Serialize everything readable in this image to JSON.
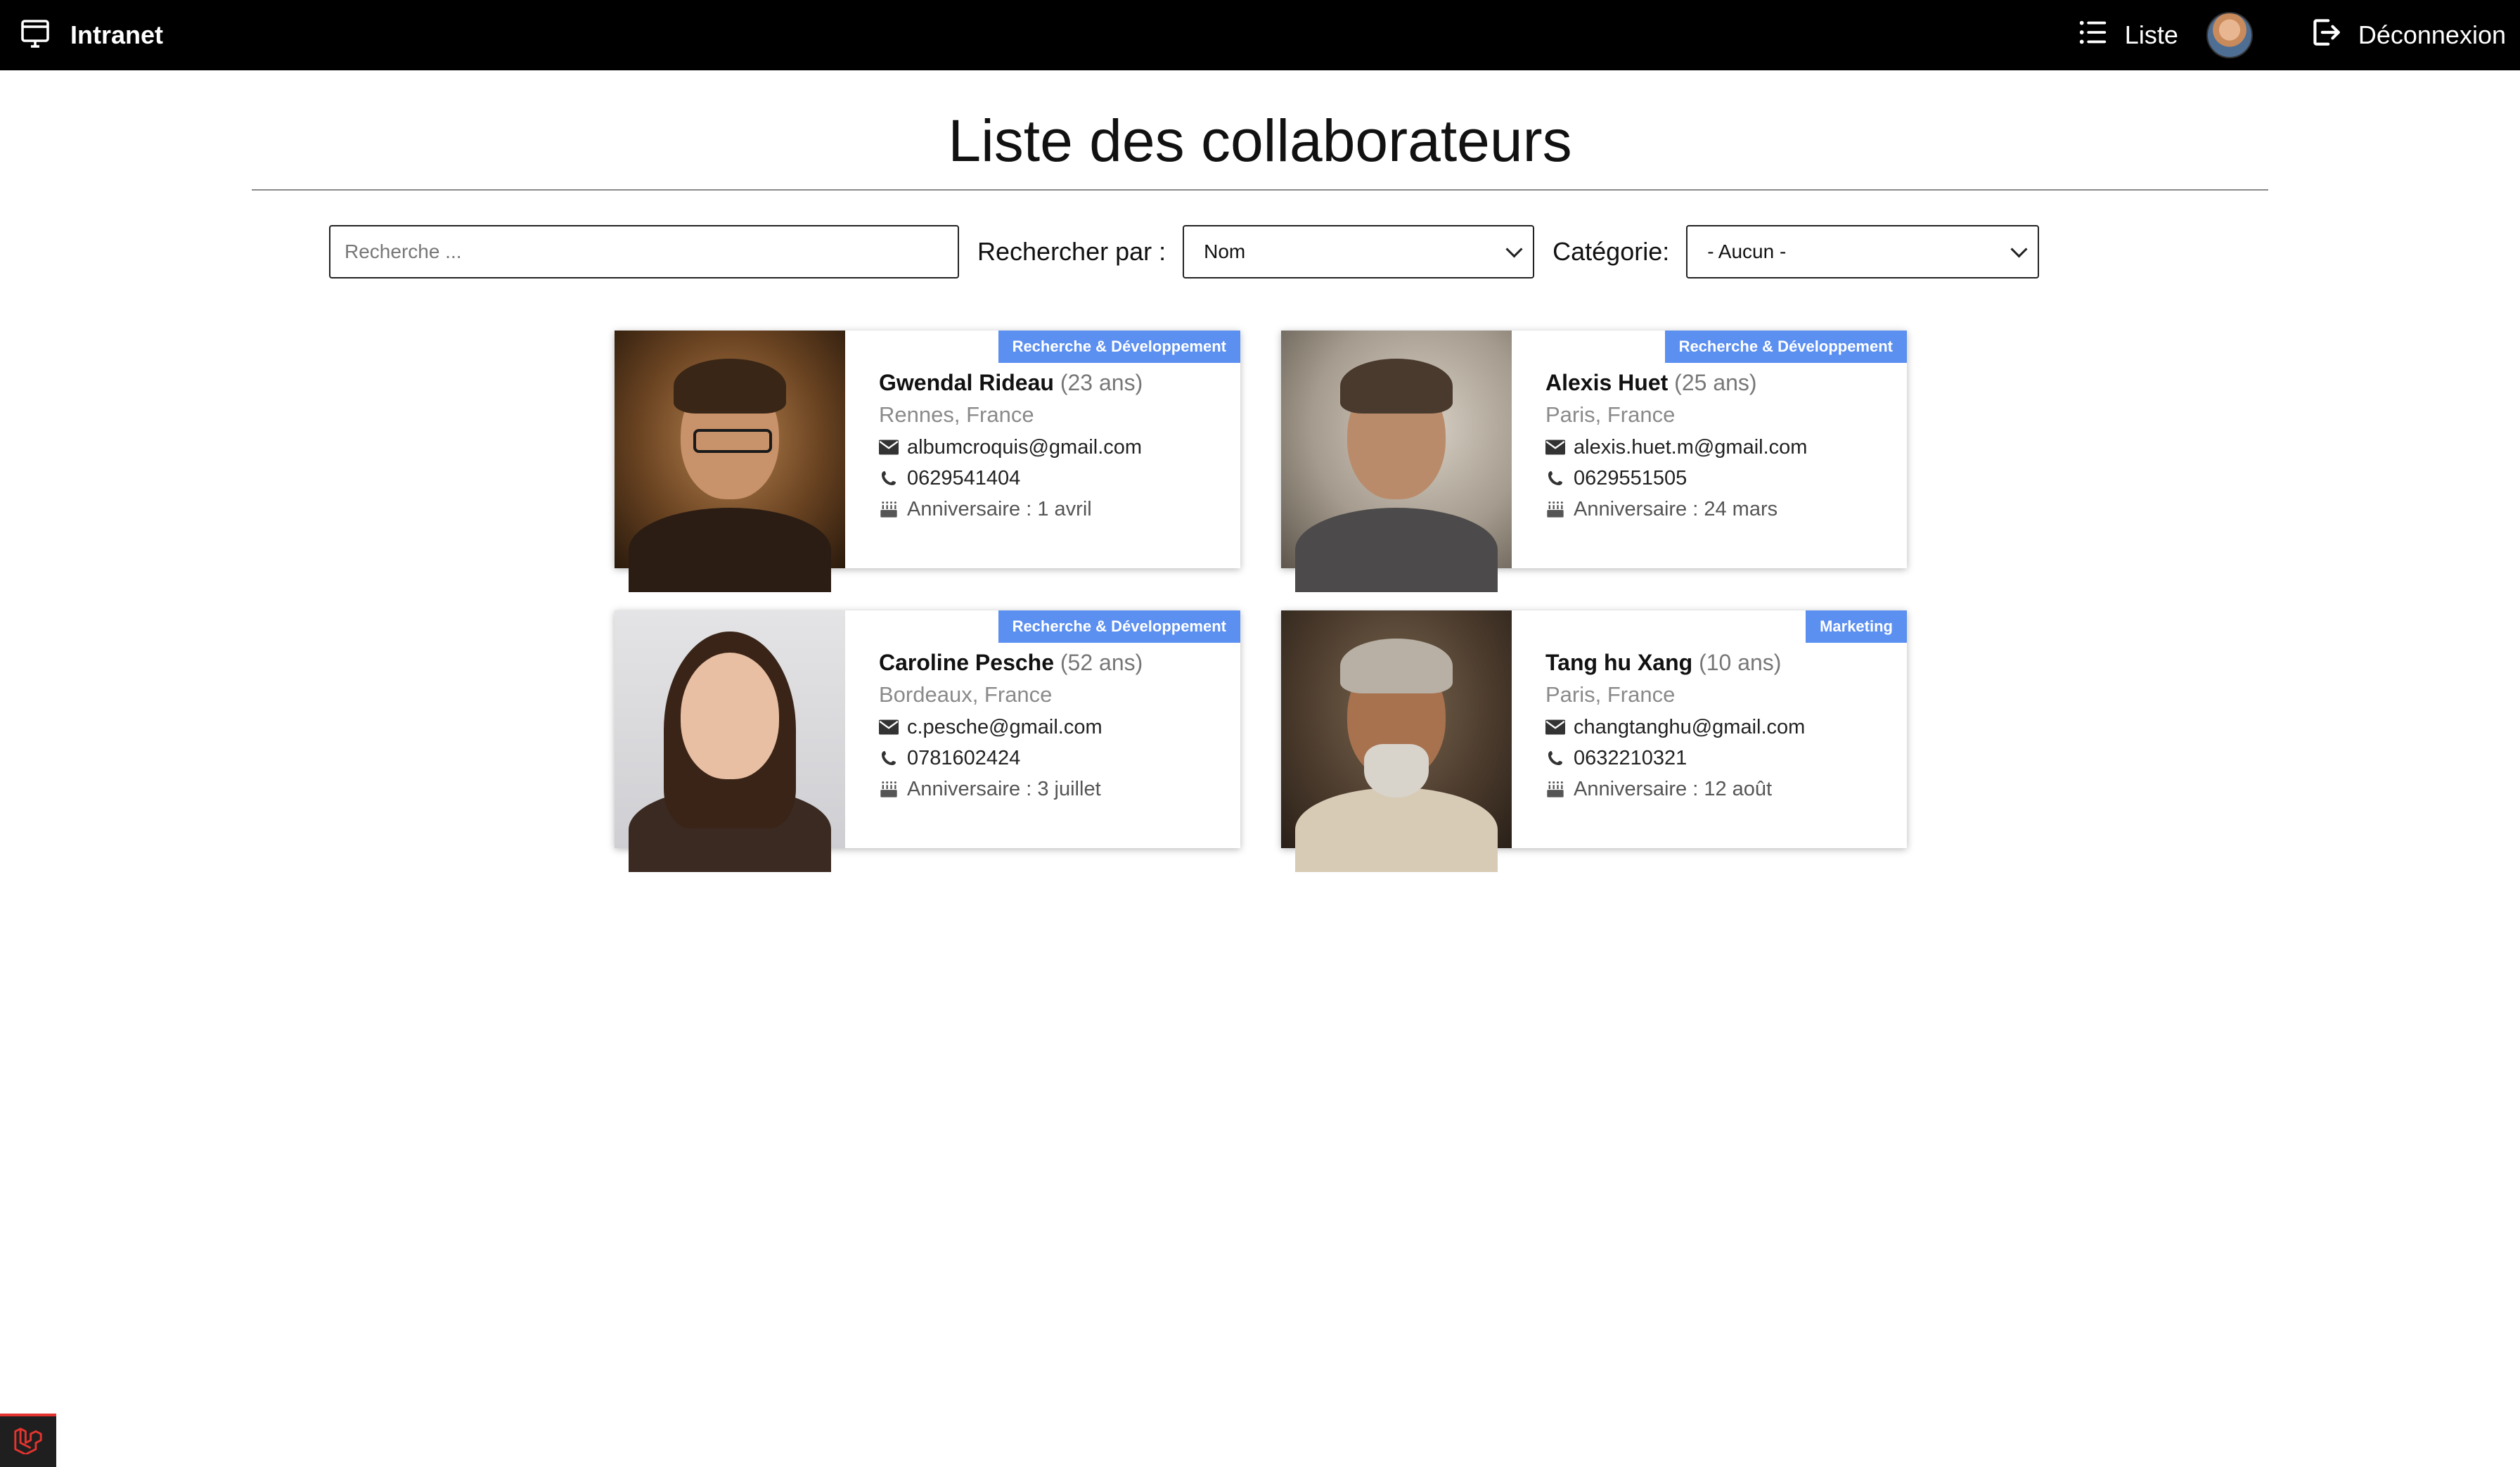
{
  "brand": {
    "label": "Intranet"
  },
  "nav": {
    "list_label": "Liste",
    "logout_label": "Déconnexion"
  },
  "page": {
    "title": "Liste des collaborateurs"
  },
  "filters": {
    "search_placeholder": "Recherche ...",
    "search_value": "",
    "search_by_label": "Rechercher par :",
    "search_by_value": "Nom",
    "category_label": "Catégorie:",
    "category_value": "- Aucun -"
  },
  "colors": {
    "tag": "#5b8ff0",
    "topbar": "#000000",
    "laravel": "#e3342f"
  },
  "collaborators": [
    {
      "category": "Recherche & Développement",
      "name": "Gwendal Rideau",
      "age": "(23 ans)",
      "city": "Rennes, France",
      "email": "albumcroquis@gmail.com",
      "phone": "0629541404",
      "birthday": "Anniversaire : 1 avril"
    },
    {
      "category": "Recherche & Développement",
      "name": "Alexis Huet",
      "age": "(25 ans)",
      "city": "Paris, France",
      "email": "alexis.huet.m@gmail.com",
      "phone": "0629551505",
      "birthday": "Anniversaire : 24 mars"
    },
    {
      "category": "Recherche & Développement",
      "name": "Caroline Pesche",
      "age": "(52 ans)",
      "city": "Bordeaux, France",
      "email": "c.pesche@gmail.com",
      "phone": "0781602424",
      "birthday": "Anniversaire : 3 juillet"
    },
    {
      "category": "Marketing",
      "name": "Tang hu Xang",
      "age": "(10 ans)",
      "city": "Paris, France",
      "email": "changtanghu@gmail.com",
      "phone": "0632210321",
      "birthday": "Anniversaire : 12 août"
    }
  ]
}
